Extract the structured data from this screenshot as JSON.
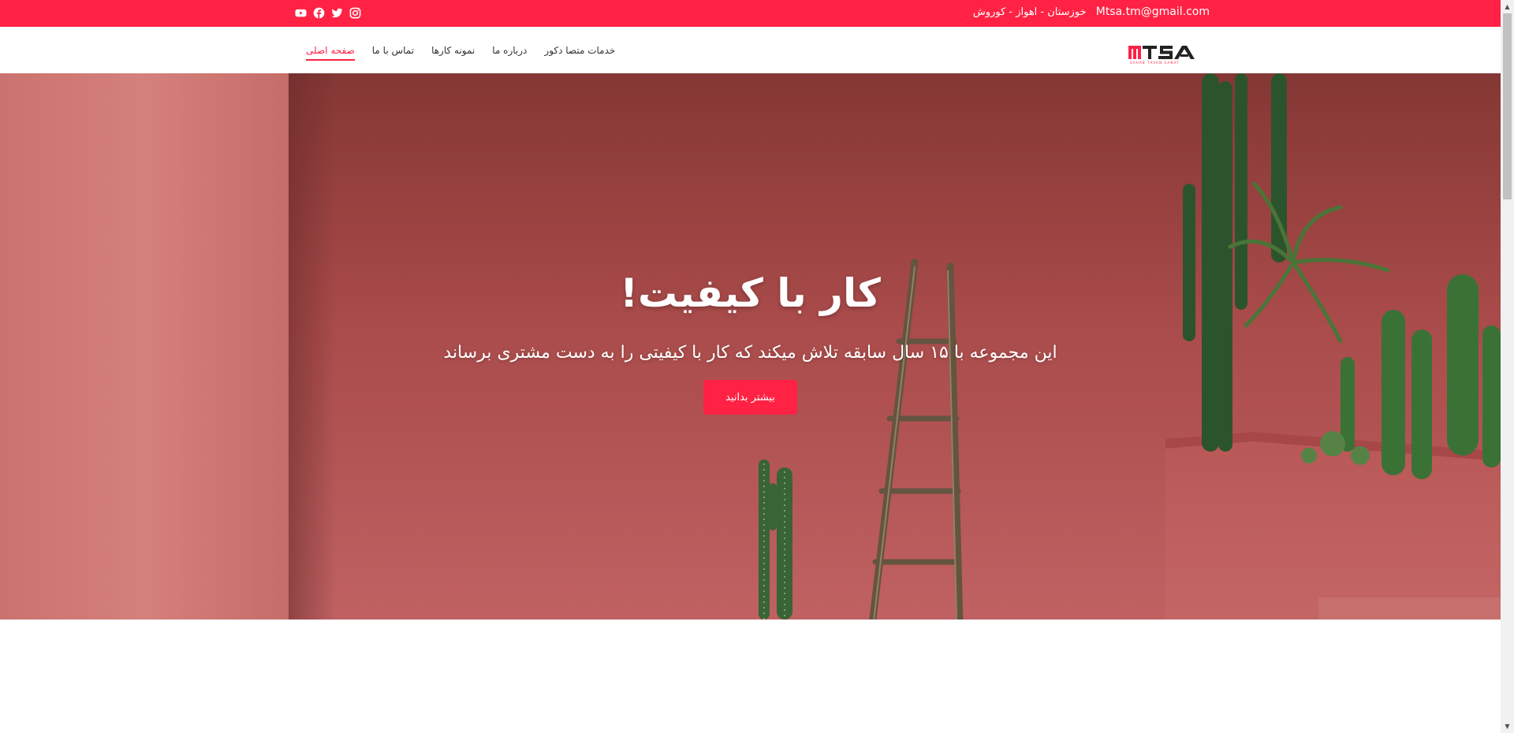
{
  "topbar": {
    "email": "Mtsa.tm@gmail.com",
    "address": "خوزستان - اهواز - کوروش",
    "social": [
      "youtube-icon",
      "facebook-icon",
      "twitter-icon",
      "instagram-icon"
    ]
  },
  "header": {
    "logo_text": "MTSA",
    "logo_tagline": "SAHAB TAVAN SANAT",
    "nav": [
      {
        "label": "صفحه اصلی",
        "active": true
      },
      {
        "label": "تماس با ما",
        "active": false
      },
      {
        "label": "نمونه کارها",
        "active": false
      },
      {
        "label": "درباره ما",
        "active": false
      },
      {
        "label": "خدمات متصا دکور",
        "active": false
      }
    ]
  },
  "hero": {
    "title": "کار با کیفیت!",
    "subtitle": "این مجموعه با ۱۵ سال سابقه تلاش میکند که کار با کیفیتی را به دست مشتری برساند",
    "button": "بیشتر بدانید"
  },
  "colors": {
    "accent": "#ff2244",
    "wall": "#c95a5c"
  }
}
